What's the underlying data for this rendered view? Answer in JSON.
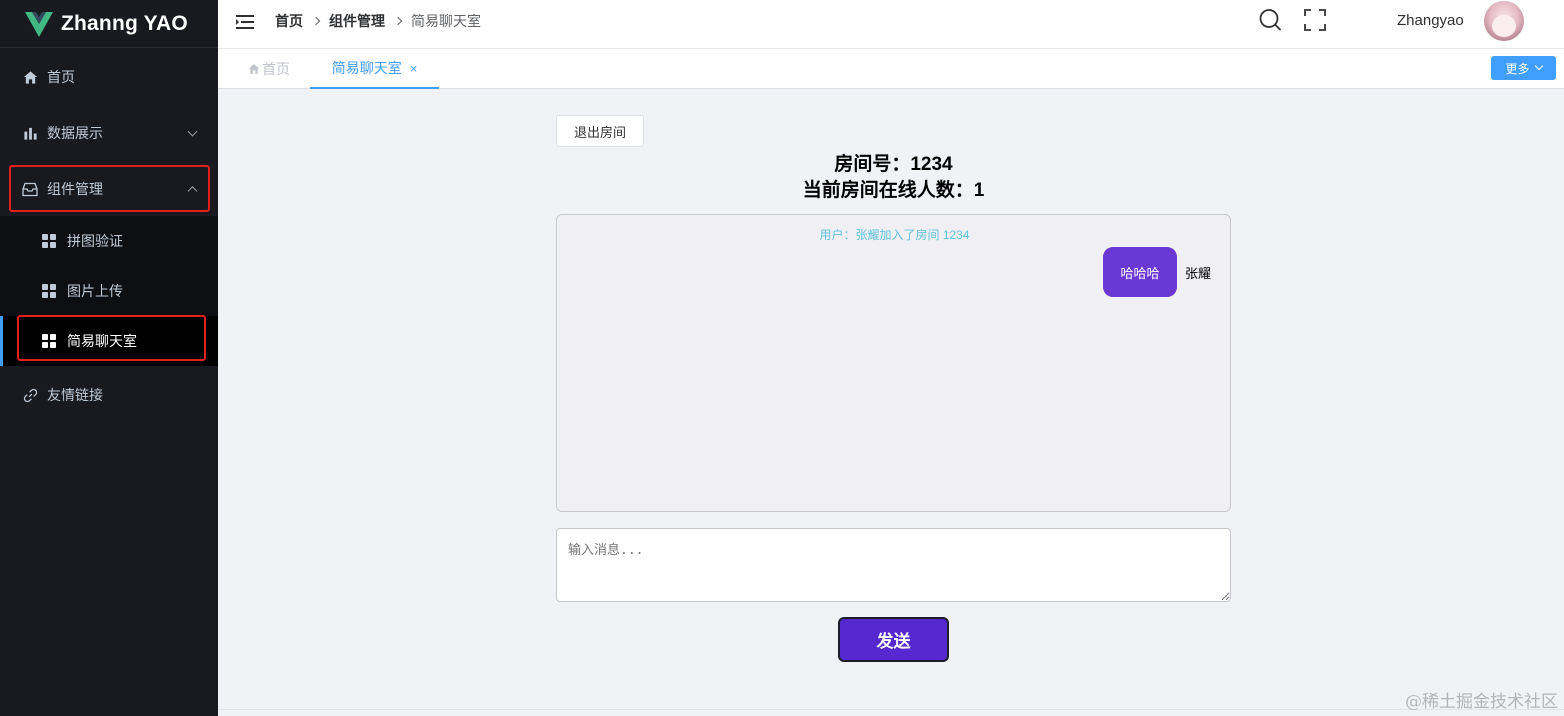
{
  "app": {
    "logo_text": "Zhanng YAO",
    "accent_color": "#409eff",
    "sidebar_bg": "#191a20"
  },
  "sidebar": {
    "items": [
      {
        "label": "首页",
        "icon": "home-icon"
      },
      {
        "label": "数据展示",
        "icon": "bar-chart-icon",
        "expanded": false
      },
      {
        "label": "组件管理",
        "icon": "inbox-icon",
        "expanded": true
      },
      {
        "label": "友情链接",
        "icon": "link-icon"
      }
    ],
    "subitems": [
      {
        "label": "拼图验证",
        "icon": "grid-icon"
      },
      {
        "label": "图片上传",
        "icon": "grid-icon"
      },
      {
        "label": "简易聊天室",
        "icon": "grid-icon",
        "active": true
      }
    ]
  },
  "header": {
    "breadcrumb": [
      "首页",
      "组件管理",
      "简易聊天室"
    ],
    "username": "Zhangyao"
  },
  "tabs": {
    "items": [
      {
        "label": "首页",
        "icon": "home-icon"
      },
      {
        "label": "简易聊天室",
        "active": true,
        "closable": true
      }
    ],
    "close_glyph": "×",
    "more_label": "更多"
  },
  "chat": {
    "leave_label": "退出房间",
    "room_line": "房间号：1234",
    "online_line": "当前房间在线人数：1",
    "system_message": "用户：张耀加入了房间 1234",
    "messages": [
      {
        "text": "哈哈哈",
        "sender": "张耀",
        "bubble_color": "#6a38d5"
      }
    ],
    "input_placeholder": "输入消息...",
    "send_label": "发送"
  },
  "watermark": "@稀土掘金技术社区"
}
